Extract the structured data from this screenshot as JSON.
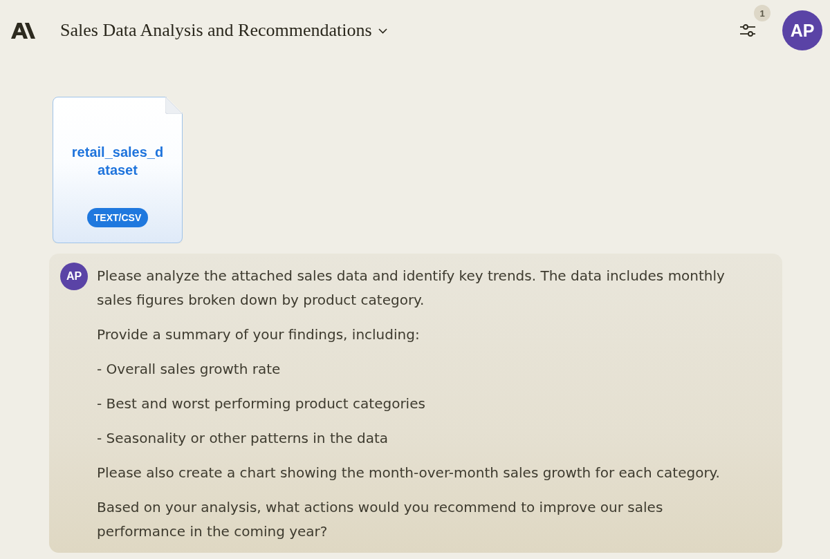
{
  "header": {
    "title": "Sales Data Analysis and Recommendations",
    "settings_badge": "1",
    "avatar_initials": "AP"
  },
  "attachment": {
    "filename": "retail_sales_dataset",
    "type": "TEXT/CSV"
  },
  "message": {
    "avatar_initials": "AP",
    "paragraphs": [
      "Please analyze the attached sales data and identify key trends. The data includes monthly sales figures broken down by product category.",
      "Provide a summary of your findings, including:",
      "- Overall sales growth rate",
      "- Best and worst performing product categories",
      "- Seasonality or other patterns in the data",
      "Please also create a chart showing the month-over-month sales growth for each category.",
      "Based on your analysis, what actions would you recommend to improve our sales performance in the coming year?"
    ]
  }
}
